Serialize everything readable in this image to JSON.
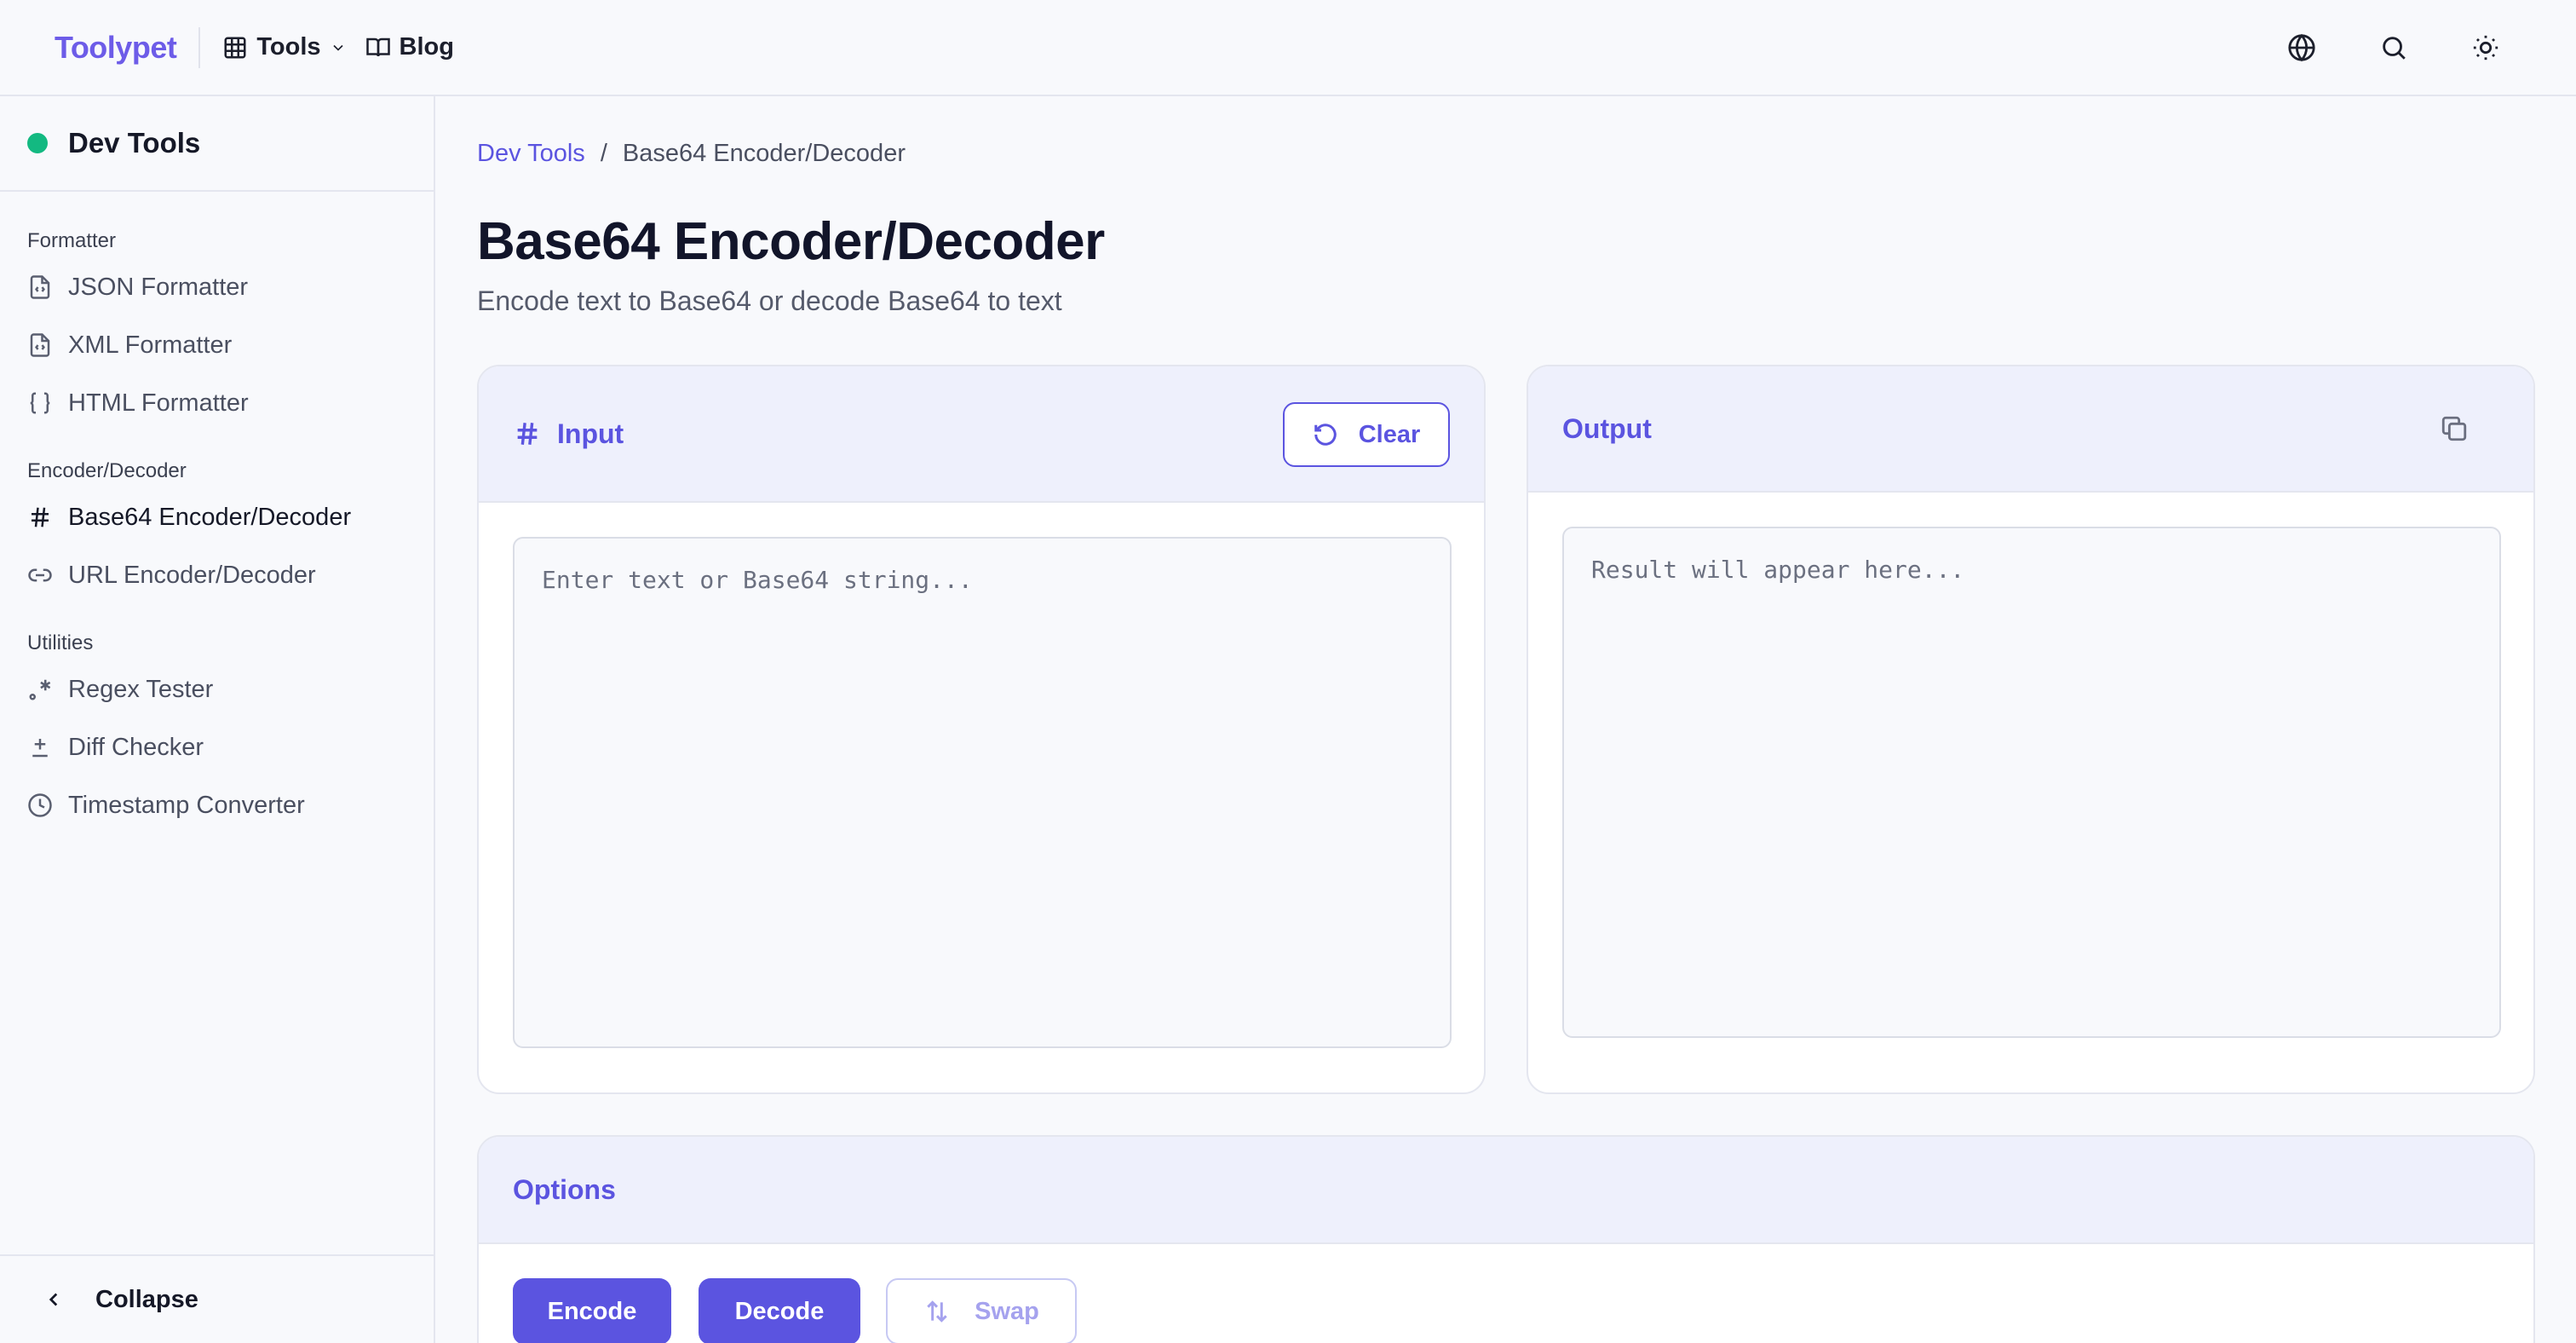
{
  "header": {
    "brand": "Toolypet",
    "nav": [
      {
        "label": "Tools",
        "icon": "grid-icon"
      },
      {
        "label": "Blog",
        "icon": "book-icon"
      }
    ],
    "right_icons": [
      "globe-icon",
      "search-icon",
      "sun-icon"
    ]
  },
  "sidebar": {
    "title": "Dev Tools",
    "status_color": "#13b981",
    "sections": [
      {
        "label": "Formatter",
        "items": [
          {
            "label": "JSON Formatter",
            "icon": "file-code-icon"
          },
          {
            "label": "XML Formatter",
            "icon": "file-code-icon"
          },
          {
            "label": "HTML Formatter",
            "icon": "braces-icon"
          }
        ]
      },
      {
        "label": "Encoder/Decoder",
        "items": [
          {
            "label": "Base64 Encoder/Decoder",
            "icon": "hash-icon",
            "active": true
          },
          {
            "label": "URL Encoder/Decoder",
            "icon": "link-icon"
          }
        ]
      },
      {
        "label": "Utilities",
        "items": [
          {
            "label": "Regex Tester",
            "icon": "regex-icon"
          },
          {
            "label": "Diff Checker",
            "icon": "plus-minus-icon"
          },
          {
            "label": "Timestamp Converter",
            "icon": "clock-icon"
          }
        ]
      }
    ],
    "collapse_label": "Collapse"
  },
  "breadcrumb": {
    "parent": "Dev Tools",
    "separator": "/",
    "current": "Base64 Encoder/Decoder"
  },
  "page": {
    "title": "Base64 Encoder/Decoder",
    "subtitle": "Encode text to Base64 or decode Base64 to text"
  },
  "input_card": {
    "title": "Input",
    "clear_label": "Clear",
    "value": "",
    "placeholder": "Enter text or Base64 string..."
  },
  "output_card": {
    "title": "Output",
    "value": "",
    "placeholder": "Result will appear here..."
  },
  "options": {
    "title": "Options",
    "encode_label": "Encode",
    "decode_label": "Decode",
    "swap_label": "Swap"
  },
  "colors": {
    "accent": "#5b54e0",
    "brand": "#6d5ce8",
    "card_header": "#eef0fc"
  }
}
